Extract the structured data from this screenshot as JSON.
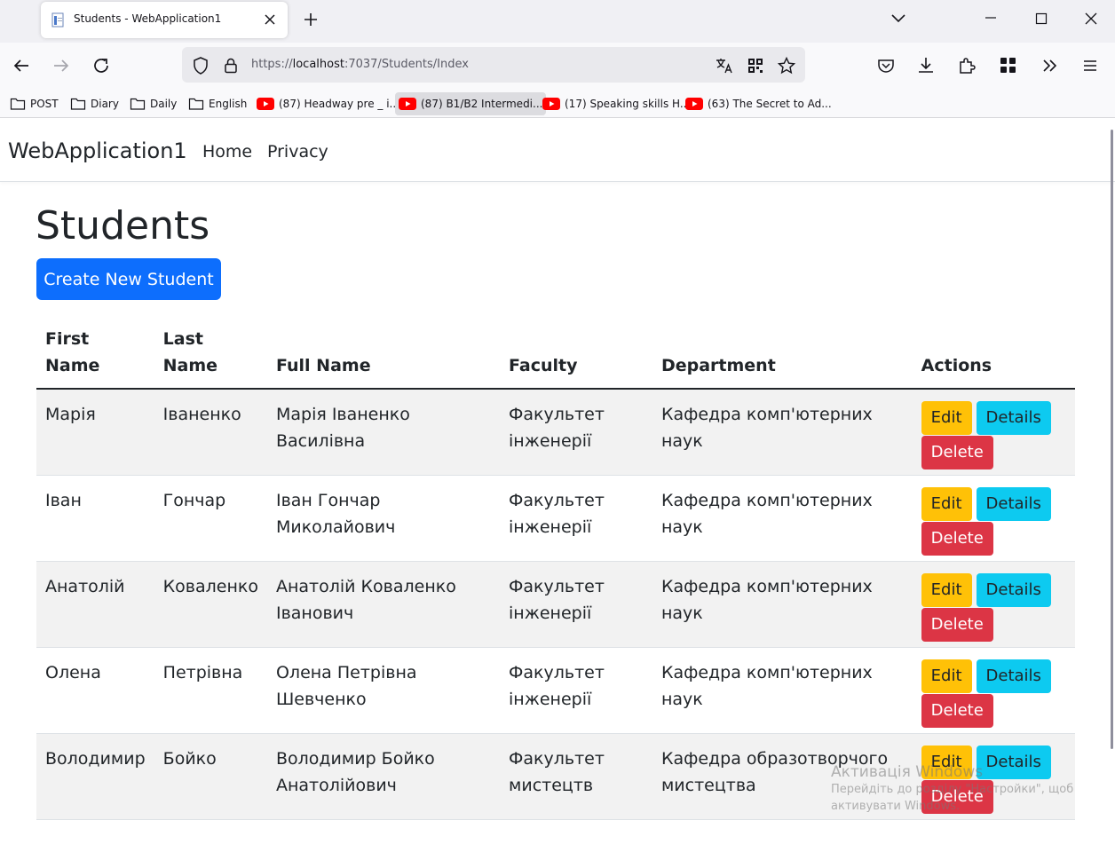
{
  "browser": {
    "tab": {
      "title": "Students - WebApplication1"
    },
    "url": {
      "prefix": "https://",
      "host": "localhost",
      "path": ":7037/Students/Index"
    },
    "bookmarks": [
      {
        "label": "POST",
        "type": "folder"
      },
      {
        "label": "Diary",
        "type": "folder"
      },
      {
        "label": "Daily",
        "type": "folder"
      },
      {
        "label": "English",
        "type": "folder"
      },
      {
        "label": "(87) Headway pre _ i...",
        "type": "youtube"
      },
      {
        "label": "(87) B1/B2 Intermedi...",
        "type": "youtube"
      },
      {
        "label": "(17) Speaking skills H...",
        "type": "youtube"
      },
      {
        "label": "(63) The Secret to Ad...",
        "type": "youtube"
      }
    ]
  },
  "site": {
    "brand": "WebApplication1",
    "nav": {
      "home": "Home",
      "privacy": "Privacy"
    }
  },
  "page": {
    "title": "Students",
    "create_button": "Create New Student",
    "columns": {
      "first_name": "First Name",
      "last_name_line1": "Last",
      "last_name_line2": "Name",
      "full_name": "Full Name",
      "faculty": "Faculty",
      "department": "Department",
      "actions": "Actions"
    },
    "action_labels": {
      "edit": "Edit",
      "details": "Details",
      "delete": "Delete"
    },
    "rows": [
      {
        "first": "Марія",
        "last": "Іваненко",
        "full": "Марія Іваненко Василівна",
        "faculty": "Факультет інженерії",
        "department": "Кафедра комп'ютерних наук"
      },
      {
        "first": "Іван",
        "last": "Гончар",
        "full": "Іван Гончар Миколайович",
        "faculty": "Факультет інженерії",
        "department": "Кафедра комп'ютерних наук"
      },
      {
        "first": "Анатолій",
        "last": "Коваленко",
        "full": "Анатолій Коваленко Іванович",
        "faculty": "Факультет інженерії",
        "department": "Кафедра комп'ютерних наук"
      },
      {
        "first": "Олена",
        "last": "Петрівна",
        "full": "Олена Петрівна Шевченко",
        "faculty": "Факультет інженерії",
        "department": "Кафедра комп'ютерних наук"
      },
      {
        "first": "Володимир",
        "last": "Бойко",
        "full": "Володимир Бойко Анатолійович",
        "faculty": "Факультет мистецтв",
        "department": "Кафедра образотворчого мистецтва"
      }
    ]
  },
  "watermark": {
    "title": "Активація Windows",
    "line1": "Перейдіть до розділу \"Настройки\", щоб",
    "line2": "активувати Windows."
  },
  "colors": {
    "primary": "#0d6efd",
    "warning": "#ffc107",
    "info": "#0dcaf0",
    "danger": "#dc3545",
    "youtube": "#ff0000"
  },
  "icons": {
    "tab_favicon": "document-icon",
    "close": "close-icon",
    "new_tab": "plus-icon",
    "list_all_tabs": "chevron-down-icon",
    "back": "back-arrow-icon",
    "forward": "forward-arrow-icon",
    "reload": "reload-icon",
    "tracking": "shield-icon",
    "security": "lock-icon",
    "translate": "translate-icon",
    "qr": "qr-code-icon",
    "bookmark": "star-icon",
    "pocket": "pocket-icon",
    "downloads": "download-icon",
    "extensions": "puzzle-icon",
    "apps": "apps-icon",
    "overflow": "double-chevron-icon",
    "menu": "hamburger-icon"
  }
}
